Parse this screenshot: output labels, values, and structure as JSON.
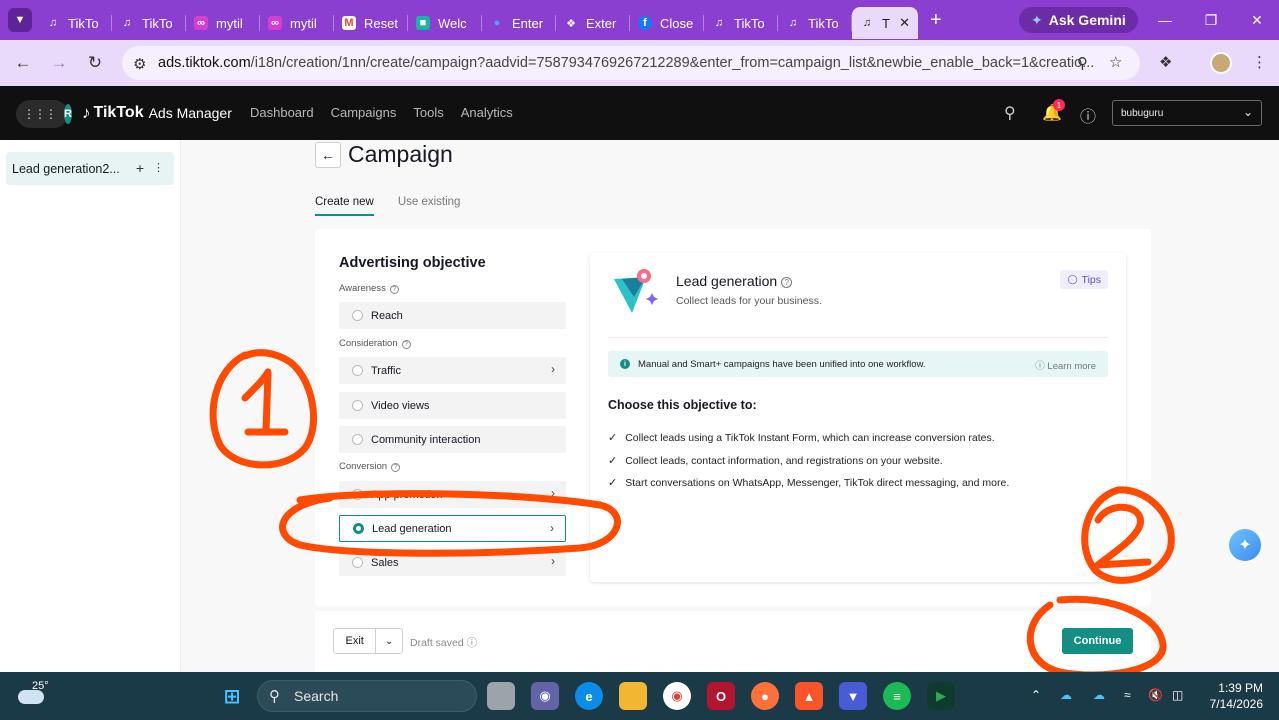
{
  "browser": {
    "tabs": [
      {
        "label": "TikTo",
        "icon": "tiktok-icon"
      },
      {
        "label": "TikTo",
        "icon": "tiktok-icon"
      },
      {
        "label": "mytil",
        "icon": "link-icon"
      },
      {
        "label": "mytil",
        "icon": "link-icon"
      },
      {
        "label": "Reset",
        "icon": "gmail-icon"
      },
      {
        "label": "Welc",
        "icon": "app-icon"
      },
      {
        "label": "Enter",
        "icon": "circle-icon"
      },
      {
        "label": "Exter",
        "icon": "puzzle-icon"
      },
      {
        "label": "Close",
        "icon": "facebook-icon"
      },
      {
        "label": "TikTo",
        "icon": "tiktok-icon"
      },
      {
        "label": "TikTo",
        "icon": "tiktok-icon"
      }
    ],
    "active_tab_label": "T",
    "ask_gemini": "Ask Gemini",
    "url_host": "ads.tiktok.com",
    "url_path": "/i18n/creation/1nn/create/campaign?aadvid=7587934769267212289&enter_from=campaign_list&newbie_enable_back=1&creatio..."
  },
  "header": {
    "brand": "TikTok",
    "brand_sub": "Ads Manager",
    "apps_initial": "R",
    "nav": [
      "Dashboard",
      "Campaigns",
      "Tools",
      "Analytics"
    ],
    "notification_count": "1",
    "account": "bubuguru"
  },
  "sidebar": {
    "item": "Lead generation2..."
  },
  "main": {
    "title": "Campaign",
    "tabs": [
      "Create new",
      "Use existing"
    ],
    "objective_title": "Advertising objective",
    "groups": {
      "awareness": "Awareness",
      "consideration": "Consideration",
      "conversion": "Conversion"
    },
    "objectives": {
      "reach": "Reach",
      "traffic": "Traffic",
      "video_views": "Video views",
      "community": "Community interaction",
      "app_promotion": "App promotion",
      "lead_generation": "Lead generation",
      "sales": "Sales"
    },
    "detail": {
      "title": "Lead generation",
      "subtitle": "Collect leads for your business.",
      "tips": "Tips",
      "notice": "Manual and Smart+ campaigns have been unified into one workflow.",
      "learn_more": "Learn more",
      "choose": "Choose this objective to:",
      "bullets": [
        "Collect leads using a TikTok Instant Form, which can increase conversion rates.",
        "Collect leads, contact information, and registrations on your website.",
        "Start conversations on WhatsApp, Messenger, TikTok direct messaging, and more."
      ]
    },
    "footer": {
      "exit": "Exit",
      "draft": "Draft saved",
      "continue": "Continue"
    }
  },
  "colors": {
    "accent": "#138e82",
    "browser_frame": "#8b3fd0",
    "annotation": "#ff4a00"
  },
  "taskbar": {
    "temperature": "25°",
    "search": "Search",
    "time": "1:39 PM",
    "date": "7/14/2026"
  }
}
